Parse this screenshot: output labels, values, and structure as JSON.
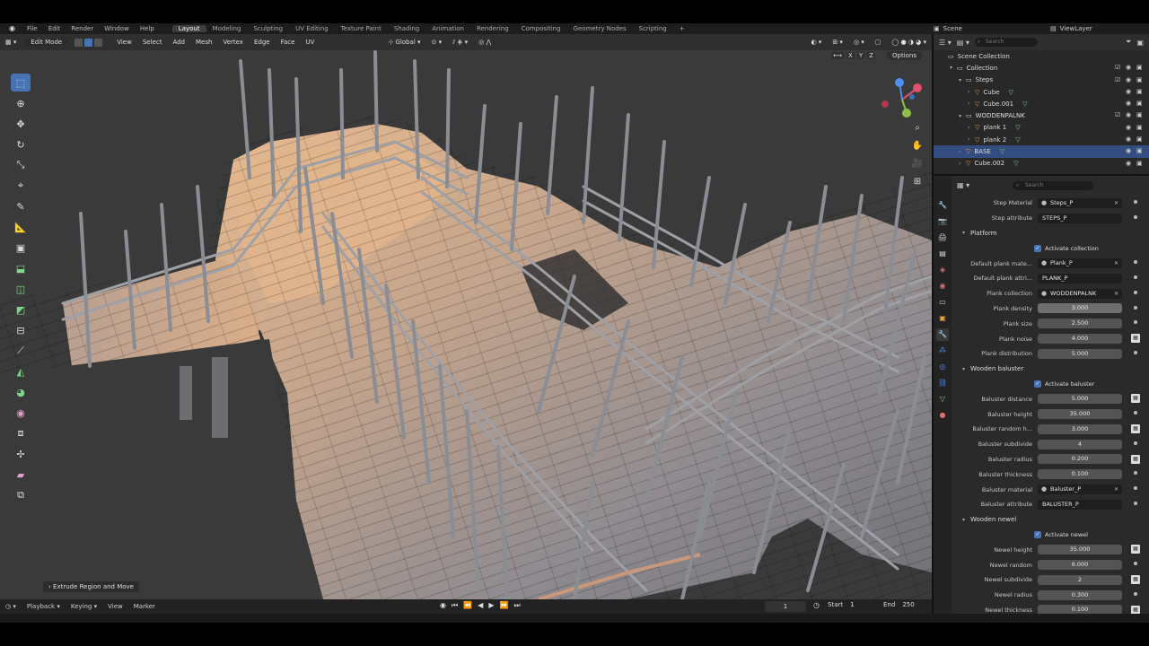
{
  "menubar": {
    "menus": [
      "File",
      "Edit",
      "Render",
      "Window",
      "Help"
    ],
    "workspaces": [
      "Layout",
      "Modeling",
      "Sculpting",
      "UV Editing",
      "Texture Paint",
      "Shading",
      "Animation",
      "Rendering",
      "Compositing",
      "Geometry Nodes",
      "Scripting"
    ],
    "active_workspace": "Layout",
    "add_workspace": "+",
    "scene": "Scene",
    "view_layer": "ViewLayer"
  },
  "viewport": {
    "mode": "Edit Mode",
    "menus": [
      "View",
      "Select",
      "Add",
      "Mesh",
      "Vertex",
      "Edge",
      "Face",
      "UV"
    ],
    "transform_orientation": "Global",
    "axis_lock": [
      "X",
      "Y",
      "Z"
    ],
    "options_label": "Options",
    "last_operator": "Extrude Region and Move"
  },
  "timeline": {
    "menus": [
      "Playback",
      "Keying",
      "View",
      "Marker"
    ],
    "current_frame": "1",
    "start_label": "Start",
    "start_value": "1",
    "end_label": "End",
    "end_value": "250"
  },
  "outliner": {
    "search_placeholder": "Search",
    "rows": [
      {
        "label": "Scene Collection",
        "indent": 0,
        "kind": "scene",
        "selected": false
      },
      {
        "label": "Collection",
        "indent": 1,
        "kind": "collection",
        "selected": false
      },
      {
        "label": "Steps",
        "indent": 2,
        "kind": "collection",
        "selected": false
      },
      {
        "label": "Cube",
        "indent": 3,
        "kind": "object",
        "selected": false
      },
      {
        "label": "Cube.001",
        "indent": 3,
        "kind": "object",
        "selected": false
      },
      {
        "label": "WODDENPALNK",
        "indent": 2,
        "kind": "collection",
        "selected": false
      },
      {
        "label": "plank 1",
        "indent": 3,
        "kind": "object",
        "selected": false
      },
      {
        "label": "plank 2",
        "indent": 3,
        "kind": "object",
        "selected": false
      },
      {
        "label": "BASE",
        "indent": 2,
        "kind": "object",
        "selected": true
      },
      {
        "label": "Cube.002",
        "indent": 2,
        "kind": "object",
        "selected": false
      }
    ]
  },
  "properties": {
    "search_placeholder": "Search",
    "items": [
      {
        "type": "field",
        "label": "Step Material",
        "value": "Steps_P",
        "style": "ptr"
      },
      {
        "type": "field",
        "label": "Step attribute",
        "value": "STEPS_P",
        "style": "dark"
      },
      {
        "type": "header",
        "label": "Platform"
      },
      {
        "type": "check",
        "label": "Activate collection"
      },
      {
        "type": "field",
        "label": "Default plank mate...",
        "value": "Plank_P",
        "style": "ptr"
      },
      {
        "type": "field",
        "label": "Default plank attri...",
        "value": "PLANK_P",
        "style": "dark"
      },
      {
        "type": "field",
        "label": "Plank collection",
        "value": "WODDENPALNK",
        "style": "ptr"
      },
      {
        "type": "field",
        "label": "Plank density",
        "value": "3.000",
        "style": "active"
      },
      {
        "type": "field",
        "label": "Plank size",
        "value": "2.500",
        "style": "num"
      },
      {
        "type": "field",
        "label": "Plank noise",
        "value": "4.000",
        "style": "num"
      },
      {
        "type": "field",
        "label": "Plank distribution",
        "value": "5.000",
        "style": "num"
      },
      {
        "type": "header",
        "label": "Wooden baluster"
      },
      {
        "type": "check",
        "label": "Activate baluster"
      },
      {
        "type": "field",
        "label": "Baluster distance",
        "value": "5.000",
        "style": "num"
      },
      {
        "type": "field",
        "label": "Baluster height",
        "value": "35.000",
        "style": "num"
      },
      {
        "type": "field",
        "label": "Baluster random h...",
        "value": "3.000",
        "style": "num"
      },
      {
        "type": "field",
        "label": "Baluster subdivide",
        "value": "4",
        "style": "num"
      },
      {
        "type": "field",
        "label": "Baluster radius",
        "value": "0.200",
        "style": "num"
      },
      {
        "type": "field",
        "label": "Baluster thickness",
        "value": "0.100",
        "style": "num"
      },
      {
        "type": "field",
        "label": "Baluster material",
        "value": "Baluster_P",
        "style": "ptr"
      },
      {
        "type": "field",
        "label": "Baluster attribute",
        "value": "BALUSTER_P",
        "style": "dark"
      },
      {
        "type": "header",
        "label": "Wooden newel"
      },
      {
        "type": "check",
        "label": "Activate newel"
      },
      {
        "type": "field",
        "label": "Newel height",
        "value": "35.000",
        "style": "num"
      },
      {
        "type": "field",
        "label": "Newel random",
        "value": "6.000",
        "style": "num"
      },
      {
        "type": "field",
        "label": "Newel subdivide",
        "value": "2",
        "style": "num"
      },
      {
        "type": "field",
        "label": "Newel radius",
        "value": "0.300",
        "style": "num"
      },
      {
        "type": "field",
        "label": "Newel thickness",
        "value": "0.100",
        "style": "num"
      }
    ]
  },
  "colors": {
    "accent": "#4772b3",
    "plank_light": "#e0b48a",
    "plank_dark": "#7d7c82",
    "background": "#3a3a3a"
  }
}
